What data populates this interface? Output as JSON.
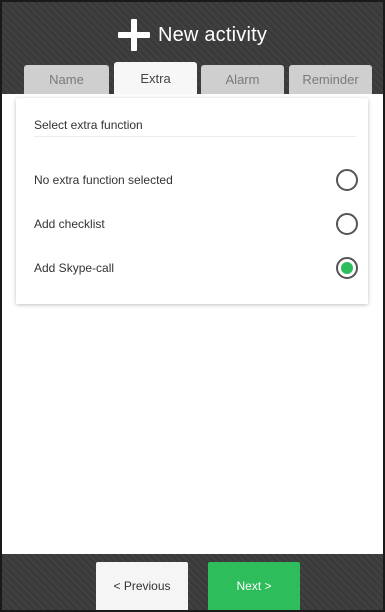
{
  "header": {
    "title": "New activity",
    "icon": "plus-icon"
  },
  "tabs": [
    {
      "label": "Name",
      "active": false
    },
    {
      "label": "Extra",
      "active": true
    },
    {
      "label": "Alarm",
      "active": false
    },
    {
      "label": "Reminder",
      "active": false
    }
  ],
  "extra": {
    "section_title": "Select extra function",
    "options": [
      {
        "label": "No extra function selected",
        "selected": false
      },
      {
        "label": "Add checklist",
        "selected": false
      },
      {
        "label": "Add Skype-call",
        "selected": true
      }
    ]
  },
  "footer": {
    "previous_label": "< Previous",
    "next_label": "Next >"
  },
  "colors": {
    "header_bg": "#3a3a3a",
    "accent_green": "#2dbd5a",
    "inactive_tab": "#cfcfcf",
    "active_tab": "#f7f7f7"
  }
}
